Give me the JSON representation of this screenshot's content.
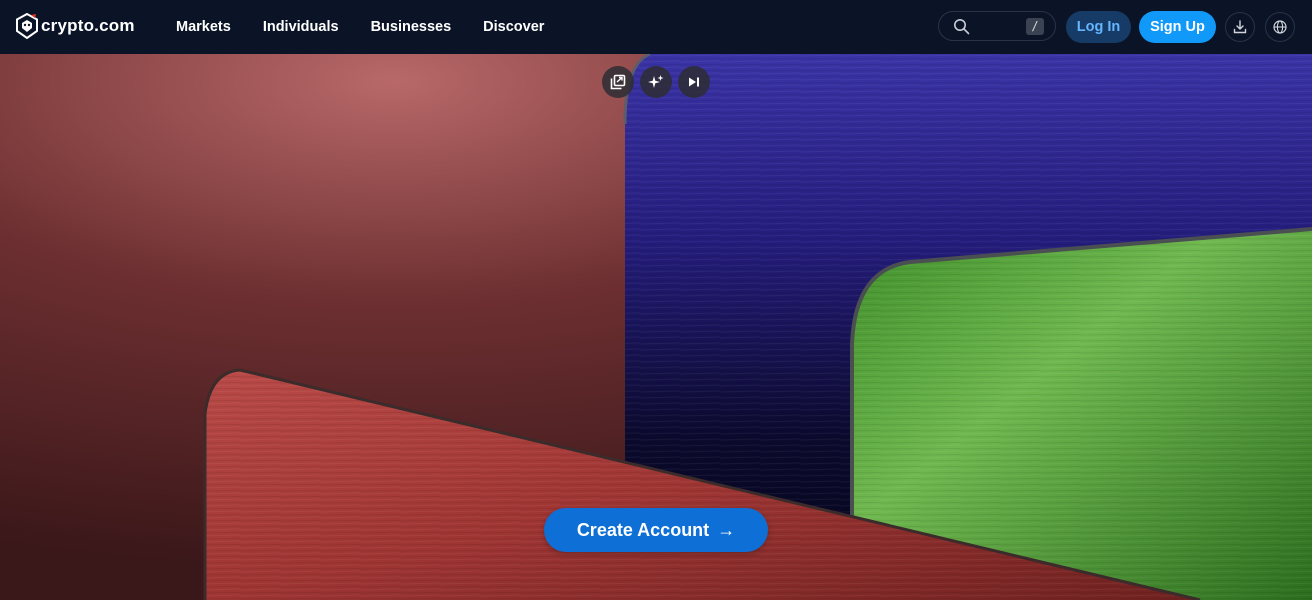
{
  "brand": {
    "name": "crypto.com",
    "icon": "crypto-lion-shield-icon"
  },
  "nav": {
    "items": [
      {
        "label": "Markets"
      },
      {
        "label": "Individuals"
      },
      {
        "label": "Businesses"
      },
      {
        "label": "Discover"
      }
    ],
    "search": {
      "shortcut": "/",
      "icon": "search-icon"
    },
    "login_label": "Log In",
    "signup_label": "Sign Up",
    "download_icon": "download-icon",
    "language_icon": "globe-icon"
  },
  "hero": {
    "controls": [
      {
        "icon": "gallery-icon"
      },
      {
        "icon": "sparkle-icon"
      },
      {
        "icon": "skip-forward-icon"
      }
    ],
    "cta_label": "Create Account",
    "cta_icon": "arrow-right-icon"
  },
  "colors": {
    "nav_bg": "#0b1426",
    "accent": "#1199fa",
    "cta": "#0e6fd6",
    "login_bg": "#163b66",
    "login_text": "#65b5ff"
  }
}
